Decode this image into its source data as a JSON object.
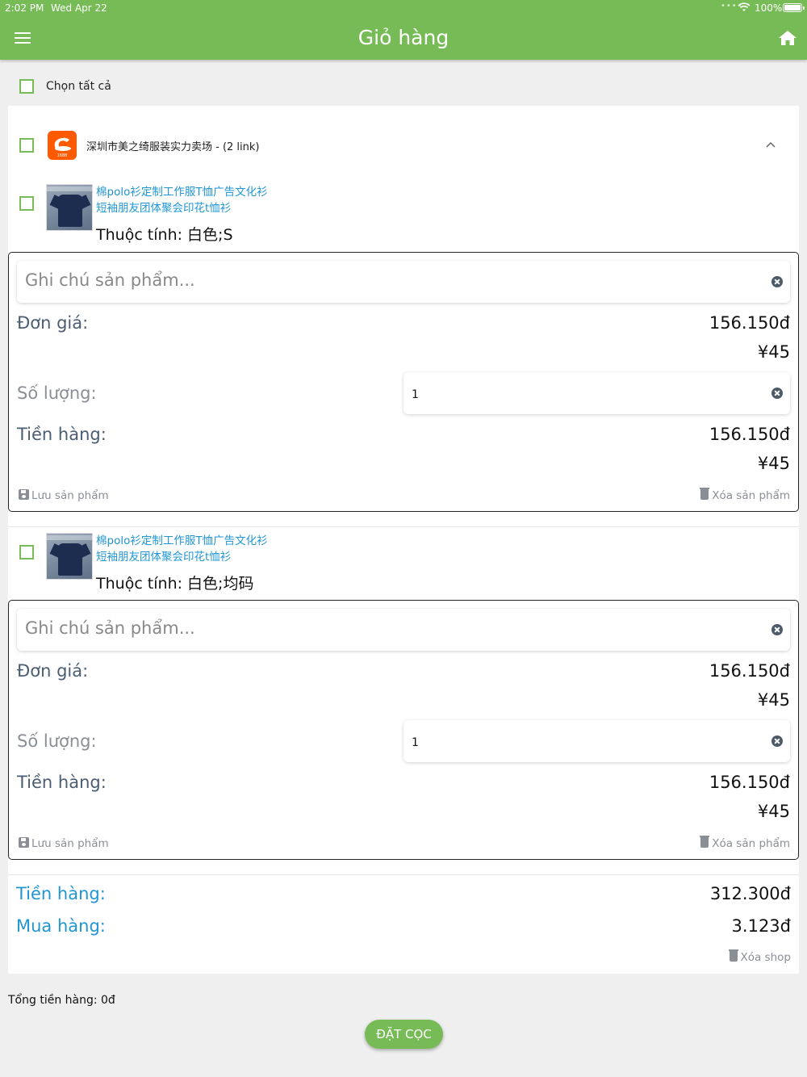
{
  "status_bar": {
    "time": "2:02 PM",
    "date": "Wed Apr 22",
    "battery": "100%"
  },
  "header": {
    "title": "Giỏ hàng",
    "menu_icon": "hamburger-menu-icon",
    "home_icon": "home-icon"
  },
  "select_all": {
    "label": "Chọn tất cả"
  },
  "shop": {
    "name": "深圳市美之绮服装实力卖场 - (2 link)",
    "logo_icon": "1688-logo",
    "items": [
      {
        "title_line1": "棉polo衫定制工作服T恤广告文化衫",
        "title_line2": "短袖朋友团体聚会印花t恤衫",
        "attributes": "Thuộc tính: 白色;S",
        "note_placeholder": "Ghi chú sản phẩm...",
        "unit_price_label": "Đơn giá:",
        "unit_price_vnd": "156.150đ",
        "unit_price_cny": "¥45",
        "quantity_label": "Số lượng:",
        "quantity": "1",
        "amount_label": "Tiền hàng:",
        "amount_vnd": "156.150đ",
        "amount_cny": "¥45",
        "save_label": "Lưu sản phẩm",
        "delete_label": "Xóa sản phẩm"
      },
      {
        "title_line1": "棉polo衫定制工作服T恤广告文化衫",
        "title_line2": "短袖朋友团体聚会印花t恤衫",
        "attributes": "Thuộc tính: 白色;均码",
        "note_placeholder": "Ghi chú sản phẩm...",
        "unit_price_label": "Đơn giá:",
        "unit_price_vnd": "156.150đ",
        "unit_price_cny": "¥45",
        "quantity_label": "Số lượng:",
        "quantity": "1",
        "amount_label": "Tiền hàng:",
        "amount_vnd": "156.150đ",
        "amount_cny": "¥45",
        "save_label": "Lưu sản phẩm",
        "delete_label": "Xóa sản phẩm"
      }
    ],
    "summary": {
      "goods_label": "Tiền hàng:",
      "goods_value": "312.300đ",
      "purchase_label": "Mua hàng:",
      "purchase_value": "3.123đ",
      "delete_shop_label": "Xóa shop"
    }
  },
  "footer": {
    "total_text": "Tổng tiền hàng: 0đ",
    "deposit_button": "ĐẶT CỌC"
  },
  "colors": {
    "brand_green": "#77bb56",
    "link_blue": "#2196d3",
    "label_slate": "#4a5d73"
  }
}
